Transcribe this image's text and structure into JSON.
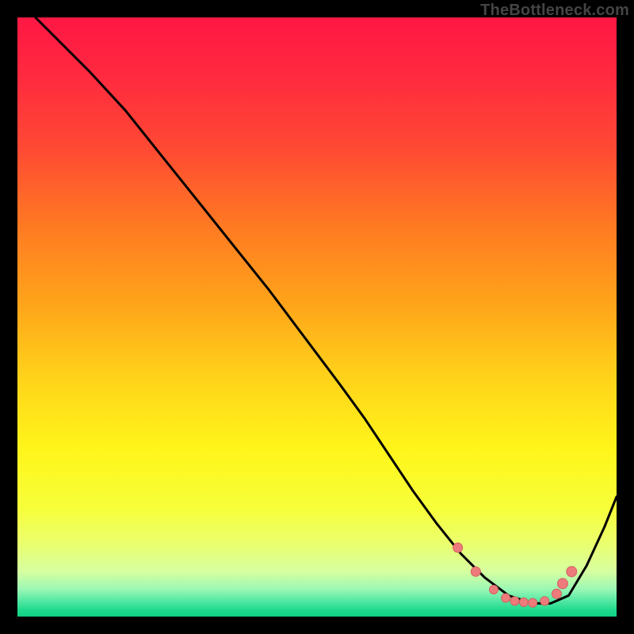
{
  "watermark": "TheBottleneck.com",
  "colors": {
    "frame": "#000000",
    "curve": "#000000",
    "dot_fill": "#ed7b7b",
    "dot_stroke": "#d46060",
    "gradient_stops": [
      {
        "offset": 0.0,
        "color": "#ff1744"
      },
      {
        "offset": 0.1,
        "color": "#ff2a3f"
      },
      {
        "offset": 0.22,
        "color": "#ff4a33"
      },
      {
        "offset": 0.35,
        "color": "#ff7a22"
      },
      {
        "offset": 0.48,
        "color": "#ffa51a"
      },
      {
        "offset": 0.6,
        "color": "#ffd21a"
      },
      {
        "offset": 0.72,
        "color": "#fff51a"
      },
      {
        "offset": 0.82,
        "color": "#f7ff3a"
      },
      {
        "offset": 0.88,
        "color": "#eaff70"
      },
      {
        "offset": 0.925,
        "color": "#d6ffa0"
      },
      {
        "offset": 0.955,
        "color": "#99f7b5"
      },
      {
        "offset": 0.975,
        "color": "#4fe7a2"
      },
      {
        "offset": 0.99,
        "color": "#1cd98a"
      },
      {
        "offset": 1.0,
        "color": "#12cf82"
      }
    ]
  },
  "chart_data": {
    "type": "line",
    "title": "",
    "xlabel": "",
    "ylabel": "",
    "xlim": [
      0,
      100
    ],
    "ylim": [
      0,
      100
    ],
    "grid": false,
    "legend": false,
    "series": [
      {
        "name": "bottleneck-curve",
        "x": [
          3,
          7,
          12,
          18,
          24,
          30,
          36,
          42,
          48,
          54,
          58,
          62,
          66,
          70,
          74,
          78,
          82,
          86,
          89,
          92,
          95,
          98,
          100
        ],
        "y": [
          100,
          96,
          91,
          84.5,
          77,
          69.5,
          62,
          54.5,
          46.5,
          38.5,
          33,
          27,
          21,
          15.5,
          10.5,
          6.5,
          3.5,
          2.2,
          2.2,
          3.5,
          8.5,
          15,
          20
        ]
      }
    ],
    "markers": {
      "name": "valley-dots",
      "x": [
        73.5,
        76.5,
        79.5,
        81.5,
        83.0,
        84.5,
        86.0,
        88.0,
        90.0,
        91.0,
        92.5
      ],
      "y": [
        11.5,
        7.5,
        4.5,
        3.1,
        2.6,
        2.4,
        2.3,
        2.6,
        3.8,
        5.5,
        7.5
      ],
      "r": [
        6,
        6,
        5.5,
        5.5,
        5.5,
        5.5,
        5.5,
        5.5,
        6,
        6.5,
        6.5
      ]
    }
  }
}
